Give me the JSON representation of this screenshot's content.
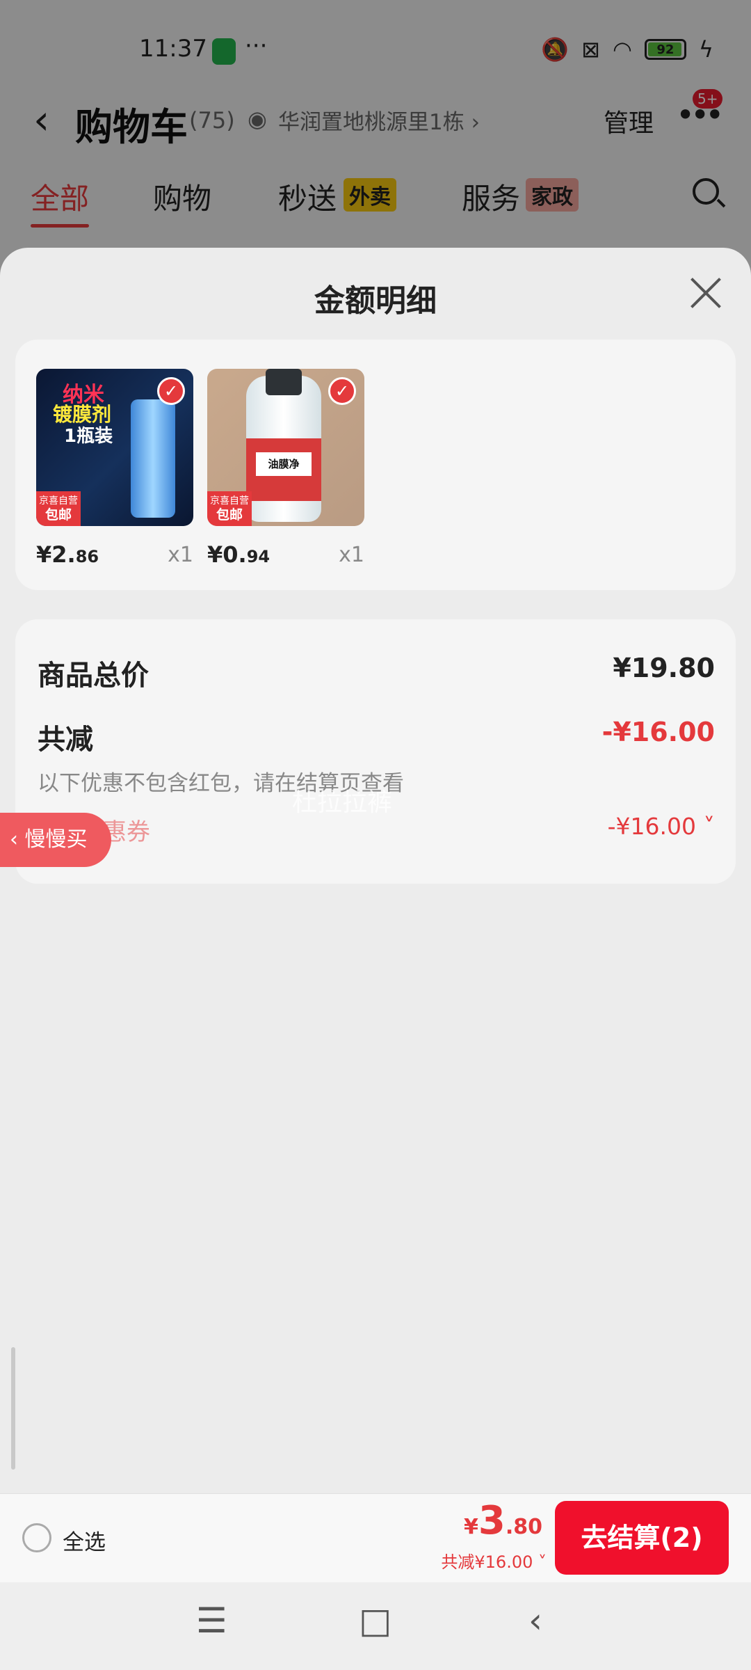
{
  "status_bar": {
    "time": "11:37",
    "more": "···",
    "battery": "92"
  },
  "header": {
    "back_icon": "chevron-left-icon",
    "title": "购物车",
    "count": "(75)",
    "address": "华润置地桃源里1栋 ›",
    "manage": "管理",
    "more_icon": "more-dots-icon",
    "badge": "5+"
  },
  "tabs": {
    "all": "全部",
    "shop": "购物",
    "instant": "秒送",
    "instant_tag": "外卖",
    "service": "服务",
    "service_tag": "家政"
  },
  "sheet": {
    "title": "金额明细",
    "products": [
      {
        "image_text_1": "纳米",
        "image_text_2": "镀膜剂",
        "image_text_3": "1瓶装",
        "corner_1": "京喜自营",
        "corner_2": "包邮",
        "price_int": "¥2.",
        "price_dec": "86",
        "qty": "x1"
      },
      {
        "image_text_1": "油膜净",
        "corner_1": "京喜自营",
        "corner_2": "包邮",
        "price_int": "¥0.",
        "price_dec": "94",
        "qty": "x1"
      }
    ],
    "total_label": "商品总价",
    "total_value": "¥19.80",
    "reduce_label": "共减",
    "reduce_value": "-¥16.00",
    "note": "以下优惠不包含红包，请在结算页查看",
    "coupon_label": "优惠券",
    "coupon_value": "-¥16.00 ˅",
    "watermark": "杜拉拉裤",
    "slow_buy": "‹ 慢慢买"
  },
  "bottom_bar": {
    "select_all": "全选",
    "price_currency": "¥",
    "price_int": "3",
    "price_dec": ".80",
    "saved": "共减¥16.00 ˅",
    "checkout": "去结算(2)"
  },
  "nav": {
    "menu": "☰",
    "home": "□",
    "back": "‹"
  },
  "colors": {
    "accent": "#e4393c",
    "checkout": "#f0102c"
  }
}
